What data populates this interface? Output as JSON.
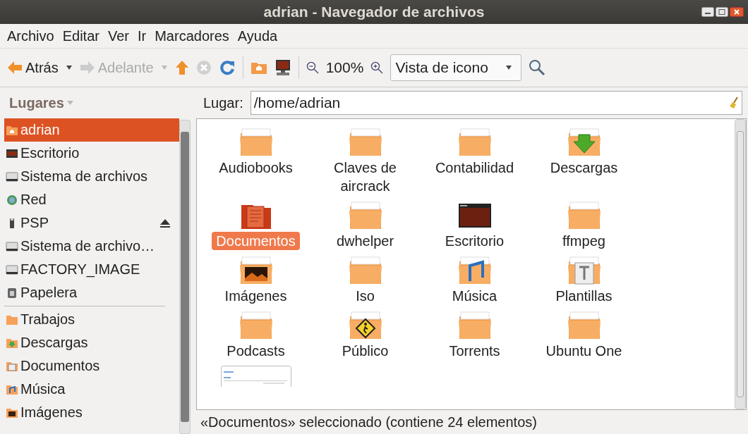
{
  "window": {
    "title": "adrian - Navegador de archivos"
  },
  "menu": [
    "Archivo",
    "Editar",
    "Ver",
    "Ir",
    "Marcadores",
    "Ayuda"
  ],
  "toolbar": {
    "back": {
      "label": "Atrás",
      "disabled": false
    },
    "forward": {
      "label": "Adelante",
      "disabled": true
    },
    "stop_disabled": true,
    "zoom": "100%",
    "view": "Vista de icono"
  },
  "sidebar": {
    "title": "Lugares",
    "items": [
      {
        "label": "adrian",
        "kind": "home",
        "selected": true,
        "eject": false
      },
      {
        "label": "Escritorio",
        "kind": "desktop",
        "selected": false,
        "eject": false
      },
      {
        "label": "Sistema de archivos",
        "kind": "drive",
        "selected": false,
        "eject": false
      },
      {
        "label": "Red",
        "kind": "network",
        "selected": false,
        "eject": false
      },
      {
        "label": "PSP",
        "kind": "usb",
        "selected": false,
        "eject": true
      },
      {
        "label": "Sistema de archivo…",
        "kind": "drive",
        "selected": false,
        "eject": false
      },
      {
        "label": "FACTORY_IMAGE",
        "kind": "drive",
        "selected": false,
        "eject": false
      },
      {
        "label": "Papelera",
        "kind": "trash",
        "selected": false,
        "eject": false
      }
    ],
    "bookmarks": [
      {
        "label": "Trabajos",
        "kind": "folder",
        "selected": false
      },
      {
        "label": "Descargas",
        "kind": "download",
        "selected": false
      },
      {
        "label": "Documentos",
        "kind": "docs",
        "selected": false
      },
      {
        "label": "Música",
        "kind": "music",
        "selected": false
      },
      {
        "label": "Imágenes",
        "kind": "pictures",
        "selected": false
      }
    ]
  },
  "location": {
    "label": "Lugar:",
    "value": "/home/adrian"
  },
  "files": [
    {
      "name": "Audiobooks",
      "kind": "folder",
      "selected": false
    },
    {
      "name": "Claves de aircrack",
      "kind": "folder",
      "selected": false
    },
    {
      "name": "Contabilidad",
      "kind": "folder",
      "selected": false
    },
    {
      "name": "Descargas",
      "kind": "download",
      "selected": false
    },
    {
      "name": "Documentos",
      "kind": "docs",
      "selected": true
    },
    {
      "name": "dwhelper",
      "kind": "folder",
      "selected": false
    },
    {
      "name": "Escritorio",
      "kind": "desktop",
      "selected": false
    },
    {
      "name": "ffmpeg",
      "kind": "folder",
      "selected": false
    },
    {
      "name": "Imágenes",
      "kind": "pictures",
      "selected": false
    },
    {
      "name": "Iso",
      "kind": "folder",
      "selected": false
    },
    {
      "name": "Música",
      "kind": "music",
      "selected": false
    },
    {
      "name": "Plantillas",
      "kind": "templates",
      "selected": false
    },
    {
      "name": "Podcasts",
      "kind": "folder",
      "selected": false
    },
    {
      "name": "Público",
      "kind": "public",
      "selected": false
    },
    {
      "name": "Torrents",
      "kind": "folder",
      "selected": false
    },
    {
      "name": "Ubuntu One",
      "kind": "folder",
      "selected": false
    },
    {
      "kind": "thumbnail",
      "selected": false
    }
  ],
  "status_bar": "«Documentos» seleccionado (contiene 24 elementos)"
}
